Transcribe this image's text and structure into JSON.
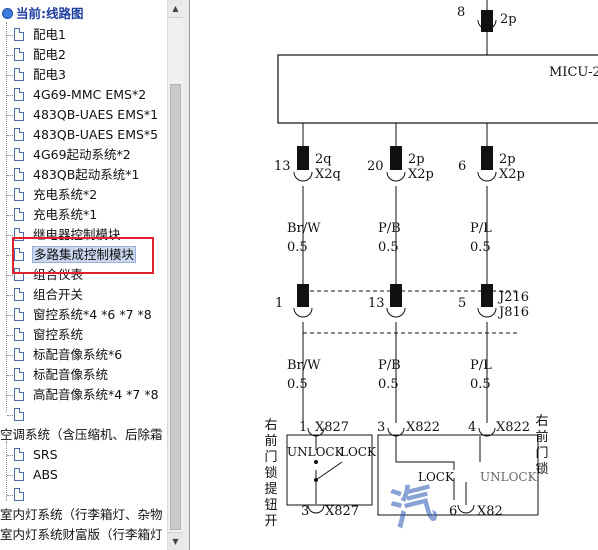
{
  "tree": {
    "root_label": "当前:线路图",
    "selected_item": "多路集成控制模块",
    "items": [
      {
        "label": "配电1"
      },
      {
        "label": "配电2"
      },
      {
        "label": "配电3"
      },
      {
        "label": "4G69-MMC EMS*2"
      },
      {
        "label": "483QB-UAES EMS*1"
      },
      {
        "label": "483QB-UAES EMS*5"
      },
      {
        "label": "4G69起动系统*2"
      },
      {
        "label": "483QB起动系统*1"
      },
      {
        "label": "充电系统*2"
      },
      {
        "label": "充电系统*1"
      },
      {
        "label": "继电器控制模块"
      },
      {
        "label": "多路集成控制模块"
      },
      {
        "label": "组合仪表"
      },
      {
        "label": "组合开关"
      },
      {
        "label": "窗控系统*4 *6 *7 *8"
      },
      {
        "label": "窗控系统"
      },
      {
        "label": "标配音像系统*6"
      },
      {
        "label": "标配音像系统"
      },
      {
        "label": "高配音像系统*4 *7 *8"
      },
      {
        "label": ""
      }
    ],
    "groups": [
      {
        "label": "空调系统（含压缩机、后除霜",
        "children": [
          "SRS",
          "ABS",
          ""
        ]
      },
      {
        "label": "室内灯系统（行李箱灯、杂物",
        "children": []
      },
      {
        "label": "室内灯系统财富版（行李箱灯",
        "children": []
      }
    ]
  },
  "diagram": {
    "module_label": "MICU-2",
    "top_pin": {
      "pin": "8",
      "conn": "2p"
    },
    "module_pins": [
      {
        "pin": "13",
        "conn": "2q",
        "sub": "X2q",
        "wire": "Br/W",
        "gauge": "0.5"
      },
      {
        "pin": "20",
        "conn": "2p",
        "sub": "X2p",
        "wire": "P/B",
        "gauge": "0.5"
      },
      {
        "pin": "6",
        "conn": "2p",
        "sub": "X2p",
        "wire": "P/L",
        "gauge": "0.5"
      }
    ],
    "junction_pins": [
      "1",
      "13",
      "5"
    ],
    "junction_conn_a": "J216",
    "junction_conn_b": "J816",
    "lower_wires": [
      {
        "wire": "Br/W",
        "gauge": "0.5"
      },
      {
        "wire": "P/B",
        "gauge": "0.5"
      },
      {
        "wire": "P/L",
        "gauge": "0.5"
      }
    ],
    "switch_pins": [
      {
        "pin": "1",
        "conn": "X827"
      },
      {
        "pin": "3",
        "conn": "X822"
      },
      {
        "pin": "4",
        "conn": "X822"
      }
    ],
    "switch_bottom_pins": [
      {
        "pin": "3",
        "conn": "X827"
      },
      {
        "pin": "6",
        "conn": "X82"
      }
    ],
    "unlock": "UNLOCK",
    "lock": "LOCK",
    "left_switch_name": "右前门锁提钮开",
    "right_switch_name": "右前门锁",
    "watermark": "汽"
  }
}
